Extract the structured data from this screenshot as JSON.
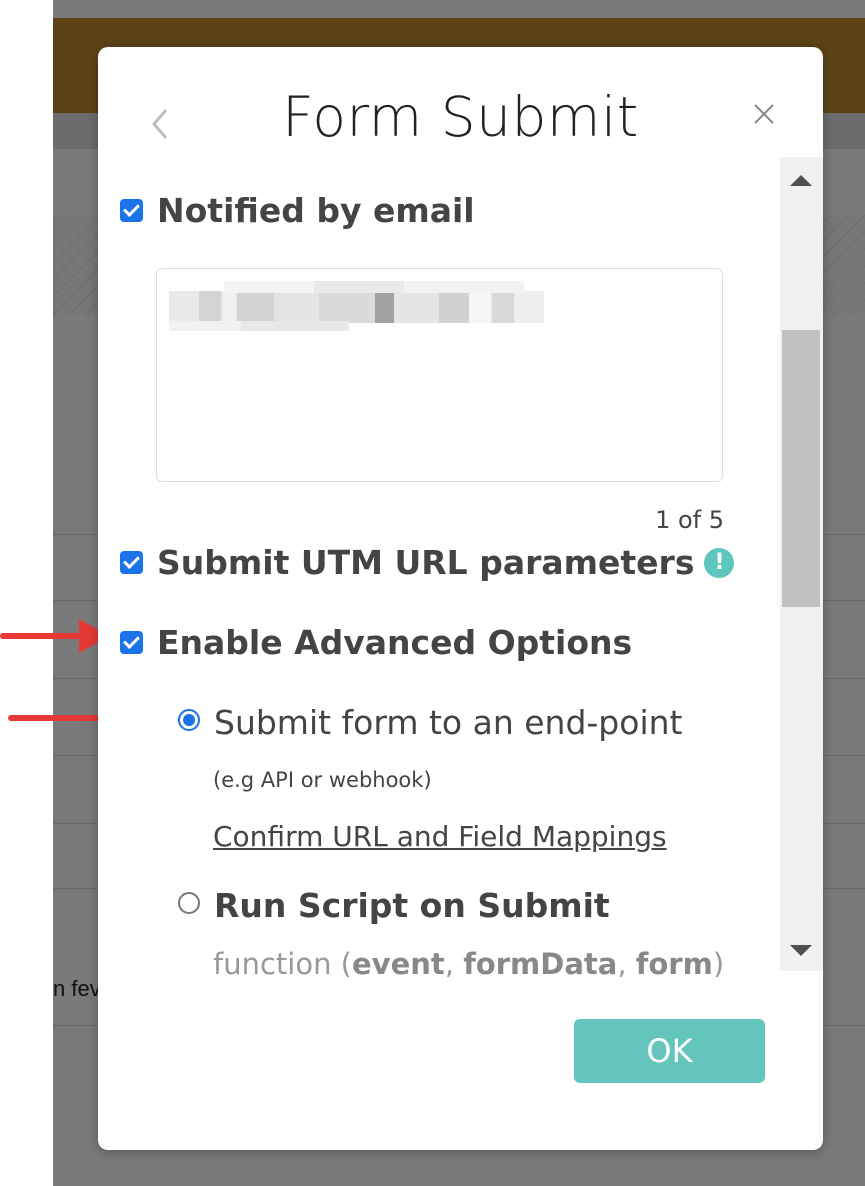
{
  "background": {
    "partial_text": "n fev"
  },
  "modal": {
    "title": "Form Submit",
    "back_icon": "chevron-left-icon",
    "close_icon": "close-icon",
    "notify": {
      "label": "Notified by email",
      "checked": true
    },
    "email_counter": "1 of 5",
    "utm": {
      "label": "Submit UTM URL parameters",
      "checked": true,
      "info_glyph": "!"
    },
    "advanced": {
      "label": "Enable Advanced Options",
      "checked": true
    },
    "endpoint": {
      "title": "Submit form to an end-point",
      "subtitle": "(e.g API or webhook)",
      "link": "Confirm URL and Field Mappings",
      "selected": true
    },
    "script": {
      "title": "Run Script on Submit",
      "fn_prefix": "function (",
      "fn_arg1": "event",
      "fn_sep1": ", ",
      "fn_arg2": "formData",
      "fn_sep2": ", ",
      "fn_arg3": "form",
      "fn_suffix": ")",
      "selected": false
    },
    "ok_label": "OK"
  },
  "colors": {
    "accent_blue": "#1a73e8",
    "ok_teal": "#63c5bc",
    "info_teal": "#5ec7bd",
    "annotation_red": "#e53935",
    "header_gold": "#b8862c"
  }
}
